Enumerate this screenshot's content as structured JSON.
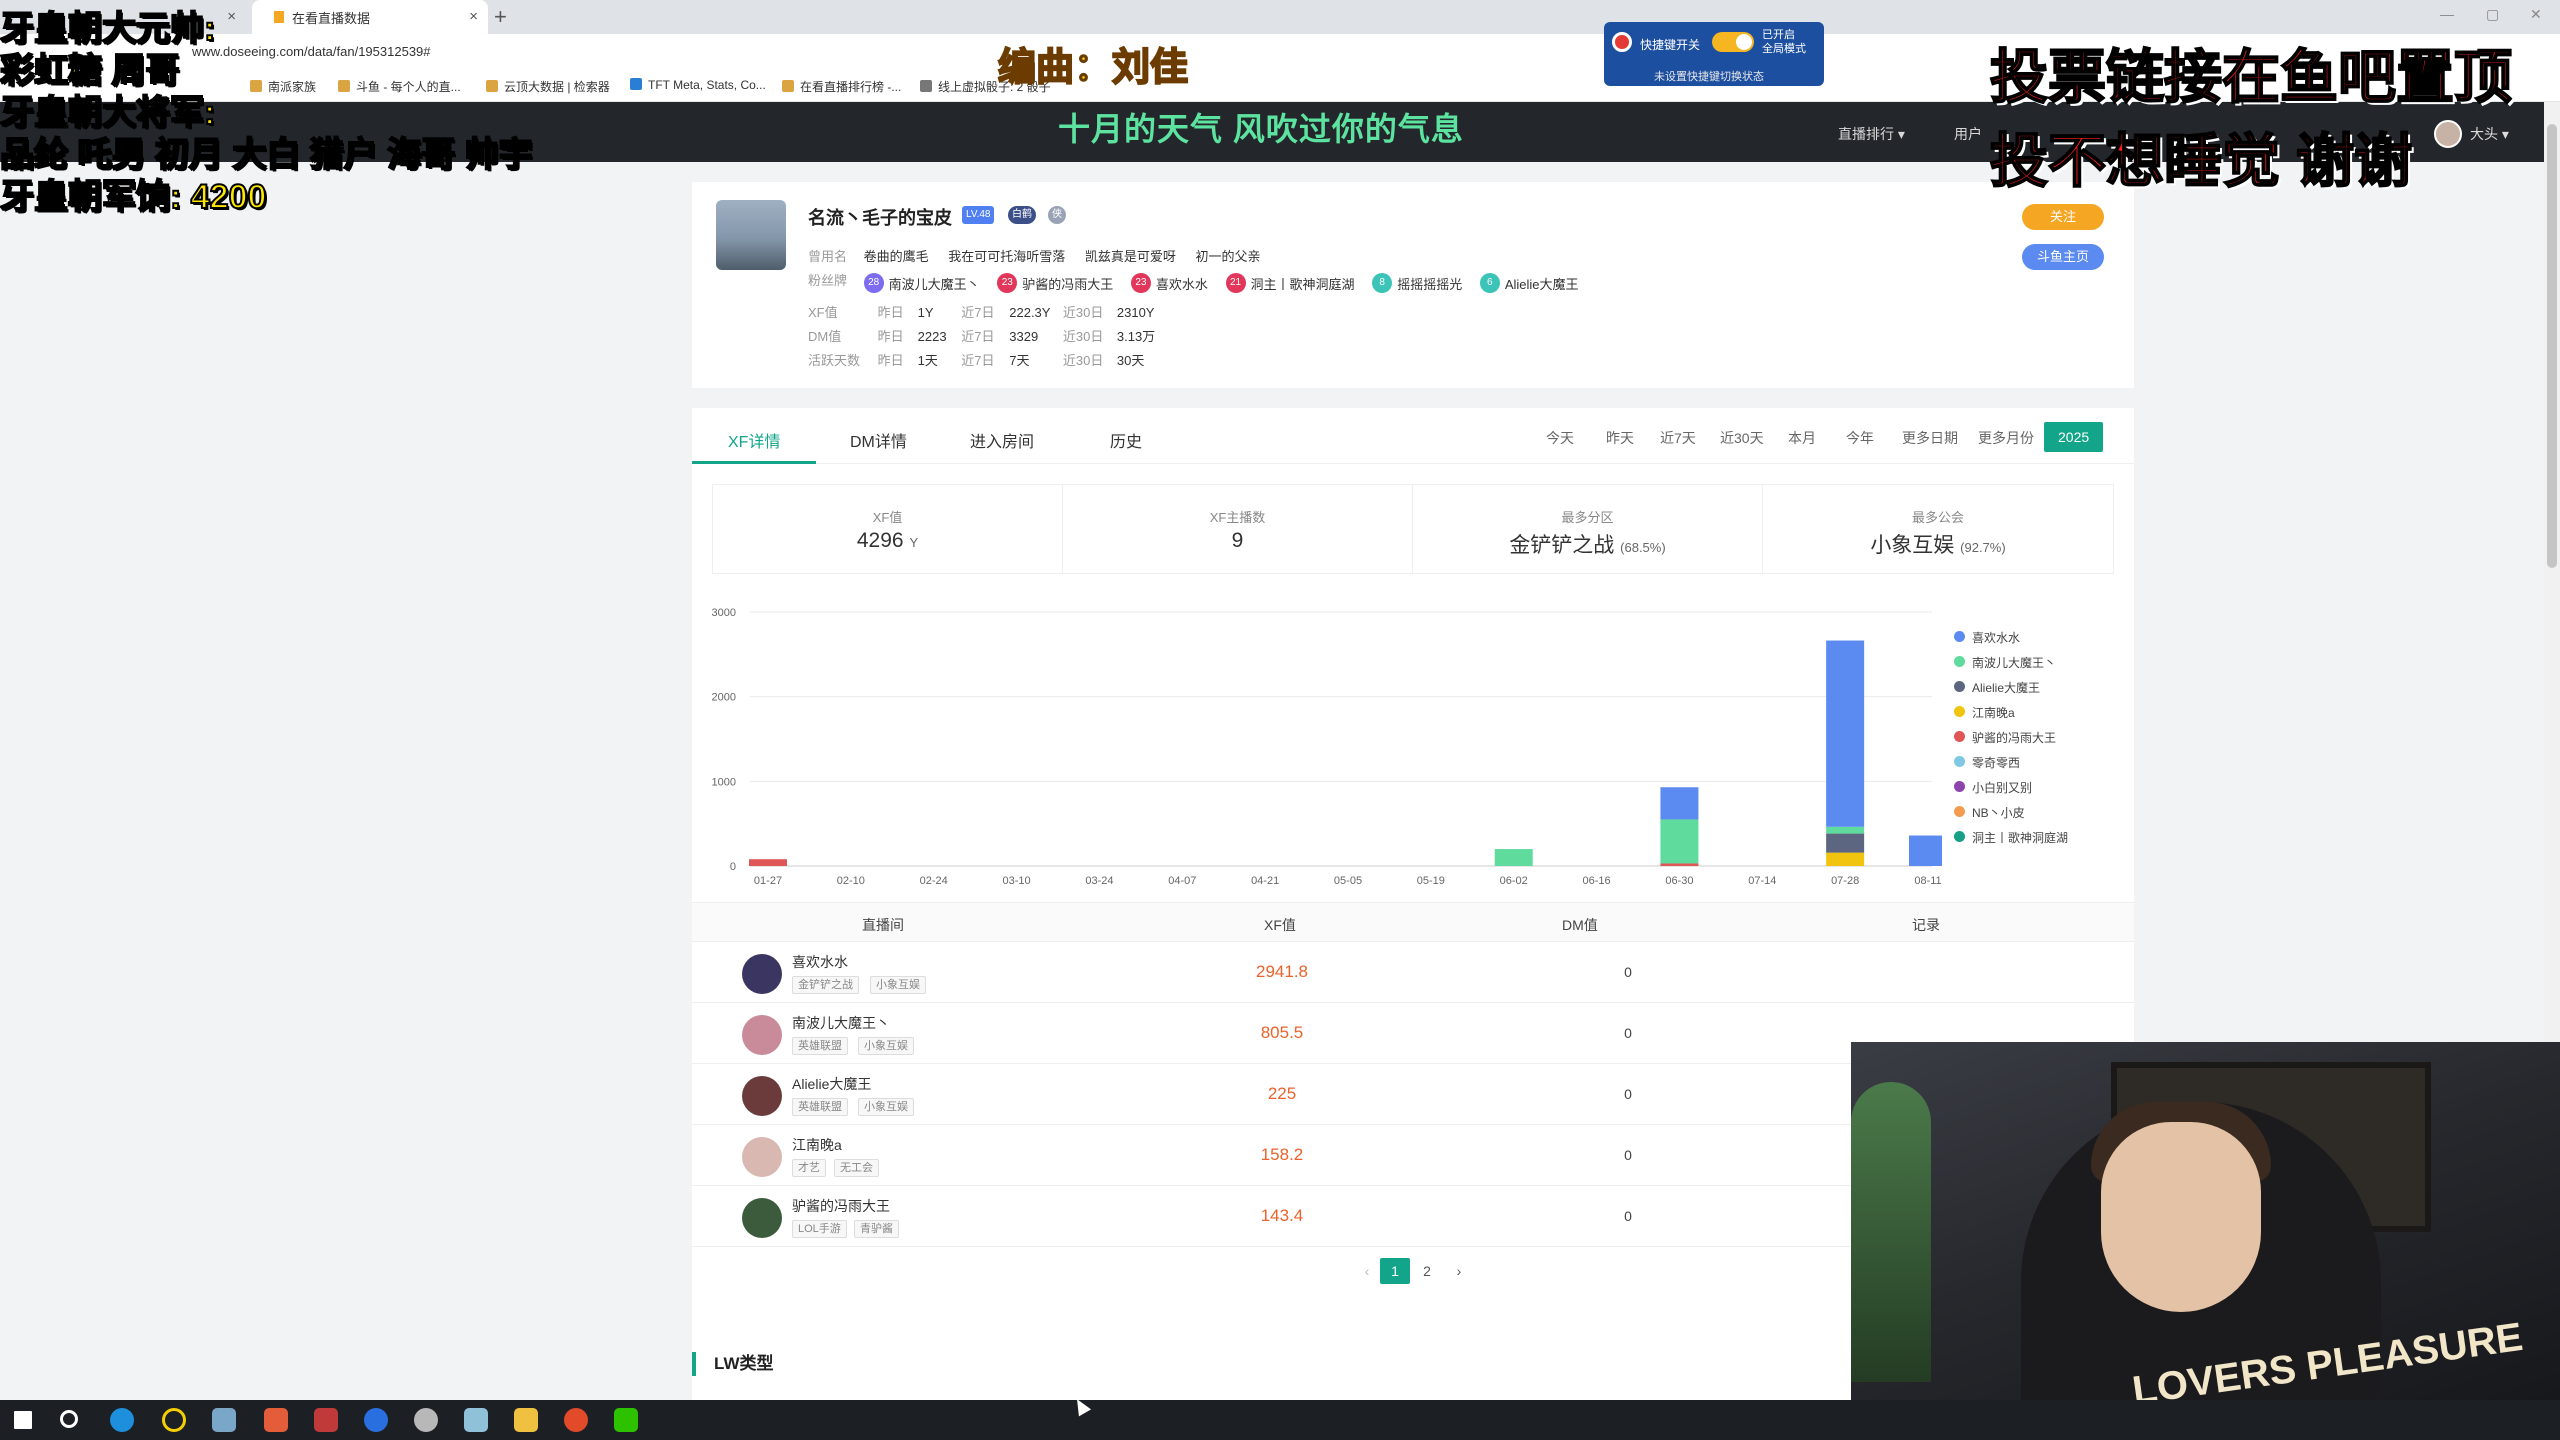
{
  "browser": {
    "tabs": [
      {
        "label": "在看直播数据",
        "active": true
      },
      {
        "label": "",
        "active": false
      }
    ],
    "url": "www.doseeing.com/data/fan/195312539#",
    "bookmarks": [
      "南派家族",
      "斗鱼 - 每个人的直...",
      "云顶大数据 | 检索器",
      "TFT Meta, Stats, Co...",
      "在看直播排行榜 -...",
      "线上虚拟骰子: 2 骰子"
    ]
  },
  "site_header": {
    "nav": [
      "直播排行 ▾",
      "用户"
    ],
    "username": "大头 ▾"
  },
  "overlays": {
    "left_lines": [
      "牙皇朝大元帅:",
      "彩虹糖 周哥",
      "牙皇朝大将军:",
      "品纶 吒男 初月 大白 猎户 海哥 帅宇",
      "牙皇朝军饷: 4200"
    ],
    "editor": "编曲：刘佳",
    "ticker": "十月的天气 风吹过你的气息",
    "right_lines": [
      "投票链接在鱼吧置顶",
      "投不想睡觉 谢谢"
    ],
    "extension": {
      "label": "快捷键开关",
      "status_line1": "已开启",
      "status_line2": "全局模式",
      "hint": "未设置快捷键切换状态"
    }
  },
  "profile": {
    "name": "名流丶毛子的宝皮",
    "badges": [
      "LV.48",
      "白鹤",
      "侠"
    ],
    "alias_label": "曾用名",
    "aliases": [
      "卷曲的鹰毛",
      "我在可可托海听雪落",
      "凯兹真是可爱呀",
      "初一的父亲"
    ],
    "fan_label": "粉丝牌",
    "fan_badges": [
      {
        "level": "28",
        "name": "南波儿大魔王丶",
        "color": "#7b6cf0"
      },
      {
        "level": "23",
        "name": "驴酱的冯雨大王",
        "color": "#e2375b"
      },
      {
        "level": "23",
        "name": "喜欢水水",
        "color": "#e2375b"
      },
      {
        "level": "21",
        "name": "洞主丨歌神洞庭湖",
        "color": "#e2375b"
      },
      {
        "level": "8",
        "name": "摇摇摇摇光",
        "color": "#3cc4b8"
      },
      {
        "level": "6",
        "name": "Alielie大魔王",
        "color": "#3cc4b8"
      }
    ],
    "stats_rows": [
      {
        "label": "XF值",
        "yesterday_label": "昨日",
        "yesterday": "1Y",
        "d7_label": "近7日",
        "d7": "222.3Y",
        "d30_label": "近30日",
        "d30": "2310Y"
      },
      {
        "label": "DM值",
        "yesterday_label": "昨日",
        "yesterday": "2223",
        "d7_label": "近7日",
        "d7": "3329",
        "d30_label": "近30日",
        "d30": "3.13万"
      },
      {
        "label": "活跃天数",
        "yesterday_label": "昨日",
        "yesterday": "1天",
        "d7_label": "近7日",
        "d7": "7天",
        "d30_label": "近30日",
        "d30": "30天"
      }
    ],
    "follow_label": "关注",
    "home_label": "斗鱼主页"
  },
  "tabs": [
    "XF详情",
    "DM详情",
    "进入房间",
    "历史"
  ],
  "ranges": [
    "今天",
    "昨天",
    "近7天",
    "近30天",
    "本月",
    "今年",
    "更多日期",
    "更多月份",
    "2025"
  ],
  "summary": [
    {
      "title": "XF值",
      "value": "4296",
      "unit": "Y"
    },
    {
      "title": "XF主播数",
      "value": "9",
      "unit": ""
    },
    {
      "title": "最多分区",
      "value": "金铲铲之战",
      "unit": "(68.5%)"
    },
    {
      "title": "最多公会",
      "value": "小象互娱",
      "unit": "(92.7%)"
    }
  ],
  "colors": {
    "accent": "#12a58a",
    "xf_value": "#e9632c"
  },
  "chart_data": {
    "type": "bar",
    "stacked": true,
    "categories": [
      "01-27",
      "02-10",
      "02-24",
      "03-10",
      "03-24",
      "04-07",
      "04-21",
      "05-05",
      "05-19",
      "06-02",
      "06-16",
      "06-30",
      "07-14",
      "07-28",
      "08-11"
    ],
    "ylim": [
      0,
      3000
    ],
    "yticks": [
      0,
      1000,
      2000,
      3000
    ],
    "grid": true,
    "legend_position": "right",
    "series": [
      {
        "name": "喜欢水水",
        "color": "#5b8af0",
        "values": [
          0,
          0,
          0,
          0,
          0,
          0,
          0,
          0,
          0,
          0,
          0,
          380,
          0,
          2200,
          360
        ]
      },
      {
        "name": "南波儿大魔王丶",
        "color": "#5fdb9e",
        "values": [
          0,
          0,
          0,
          0,
          0,
          0,
          0,
          0,
          0,
          200,
          0,
          520,
          0,
          80,
          0
        ]
      },
      {
        "name": "Alielie大魔王",
        "color": "#5c6680",
        "values": [
          0,
          0,
          0,
          0,
          0,
          0,
          0,
          0,
          0,
          0,
          0,
          0,
          0,
          225,
          0
        ]
      },
      {
        "name": "江南晚a",
        "color": "#f1c40f",
        "values": [
          0,
          0,
          0,
          0,
          0,
          0,
          0,
          0,
          0,
          0,
          0,
          0,
          0,
          158,
          0
        ]
      },
      {
        "name": "驴酱的冯雨大王",
        "color": "#e05555",
        "values": [
          80,
          0,
          0,
          0,
          0,
          0,
          0,
          0,
          0,
          0,
          0,
          30,
          0,
          0,
          0
        ]
      },
      {
        "name": "零奇零西",
        "color": "#7ec8e3",
        "values": [
          0,
          0,
          0,
          0,
          0,
          0,
          0,
          0,
          0,
          0,
          0,
          0,
          0,
          0,
          0
        ]
      },
      {
        "name": "小白别又别",
        "color": "#8e44ad",
        "values": [
          0,
          0,
          0,
          0,
          0,
          0,
          0,
          0,
          0,
          0,
          0,
          0,
          0,
          0,
          0
        ]
      },
      {
        "name": "NB丶小皮",
        "color": "#f39c50",
        "values": [
          0,
          0,
          0,
          0,
          0,
          0,
          0,
          0,
          0,
          0,
          0,
          0,
          0,
          0,
          0
        ]
      },
      {
        "name": "洞主丨歌神洞庭湖",
        "color": "#16a085",
        "values": [
          0,
          0,
          0,
          0,
          0,
          0,
          0,
          0,
          0,
          0,
          0,
          0,
          0,
          0,
          0
        ]
      }
    ]
  },
  "table": {
    "headers": [
      "直播间",
      "XF值",
      "DM值",
      "记录"
    ],
    "rows": [
      {
        "name": "喜欢水水",
        "tags": [
          "金铲铲之战",
          "小象互娱"
        ],
        "xf": "2941.8",
        "dm": "0",
        "avatar_color": "#3b3561"
      },
      {
        "name": "南波儿大魔王丶",
        "tags": [
          "英雄联盟",
          "小象互娱"
        ],
        "xf": "805.5",
        "dm": "0",
        "avatar_color": "#c98a9a"
      },
      {
        "name": "Alielie大魔王",
        "tags": [
          "英雄联盟",
          "小象互娱"
        ],
        "xf": "225",
        "dm": "0",
        "avatar_color": "#6b3a3a"
      },
      {
        "name": "江南晚a",
        "tags": [
          "才艺",
          "无工会"
        ],
        "xf": "158.2",
        "dm": "0",
        "avatar_color": "#d8b8b0"
      },
      {
        "name": "驴酱的冯雨大王",
        "tags": [
          "LOL手游",
          "青驴酱"
        ],
        "xf": "143.4",
        "dm": "0",
        "avatar_color": "#3c5a3c"
      }
    ]
  },
  "pagination": {
    "pages": [
      "1",
      "2"
    ],
    "current": "1",
    "prev": "‹",
    "next": "›"
  },
  "section_title": "LW类型",
  "webcam_shirt_text": "LOVERS PLEASURE"
}
